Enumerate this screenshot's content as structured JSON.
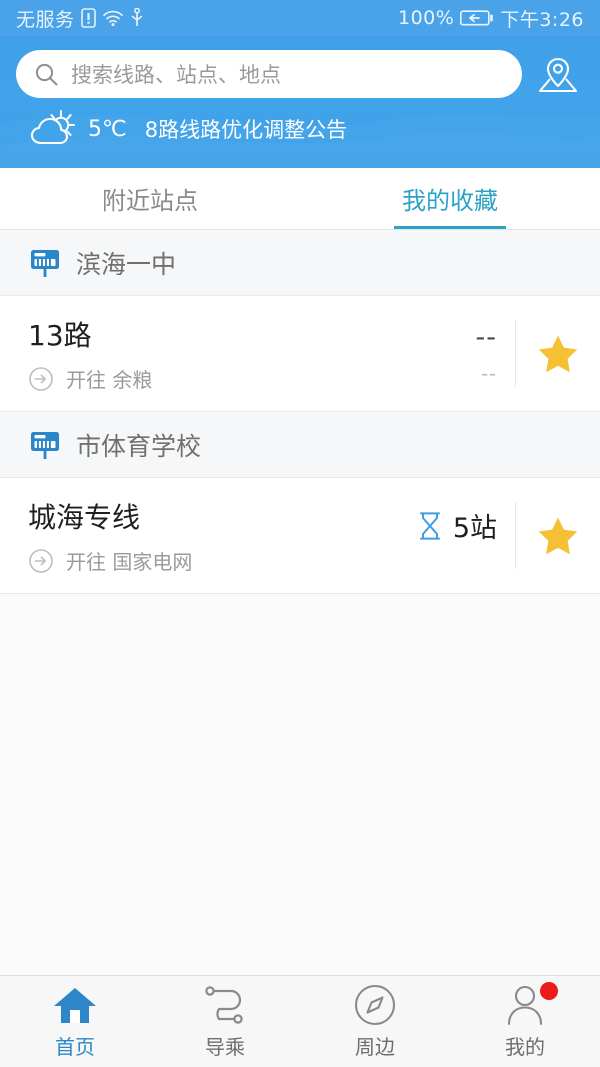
{
  "statusbar": {
    "carrier": "无服务",
    "battery_percent": "100%",
    "time": "下午3:26",
    "icons": [
      "sim-alert-icon",
      "wifi-icon",
      "usb-icon",
      "battery-charging-icon"
    ]
  },
  "header": {
    "search": {
      "placeholder": "搜索线路、站点、地点",
      "icon": "search-icon"
    },
    "location_button_icon": "map-pin-icon",
    "weather": {
      "icon": "sun-behind-cloud-icon",
      "temperature": "5℃",
      "notice": "8路线路优化调整公告"
    }
  },
  "tabs": [
    {
      "label": "附近站点",
      "active": false
    },
    {
      "label": "我的收藏",
      "active": true
    }
  ],
  "colors": {
    "header_blue": "#41a4ea",
    "accent_tab": "#2ba3c7",
    "star_gold": "#f5c034",
    "badge_red": "#ed1b1b",
    "nav_active": "#2c86c8",
    "stop_icon_blue": "#2a86c8"
  },
  "groups": [
    {
      "station_icon": "bus-stop-sign-icon",
      "station_name": "滨海一中",
      "routes": [
        {
          "name": "13路",
          "direction_icon": "arrow-right-circle-icon",
          "direction": "开往 余粮",
          "eta_icon": "",
          "eta_main": "--",
          "eta_sub": "--",
          "favorite_icon": "star-icon",
          "favorited": true
        }
      ]
    },
    {
      "station_icon": "bus-stop-sign-icon",
      "station_name": "市体育学校",
      "routes": [
        {
          "name": "城海专线",
          "direction_icon": "arrow-right-circle-icon",
          "direction": "开往 国家电网",
          "eta_icon": "hourglass-icon",
          "eta_main": "5站",
          "eta_sub": "",
          "favorite_icon": "star-icon",
          "favorited": true
        }
      ]
    }
  ],
  "bottomnav": [
    {
      "label": "首页",
      "icon": "home-icon",
      "active": true,
      "badge": false
    },
    {
      "label": "导乘",
      "icon": "route-icon",
      "active": false,
      "badge": false
    },
    {
      "label": "周边",
      "icon": "compass-icon",
      "active": false,
      "badge": false
    },
    {
      "label": "我的",
      "icon": "person-icon",
      "active": false,
      "badge": true
    }
  ]
}
